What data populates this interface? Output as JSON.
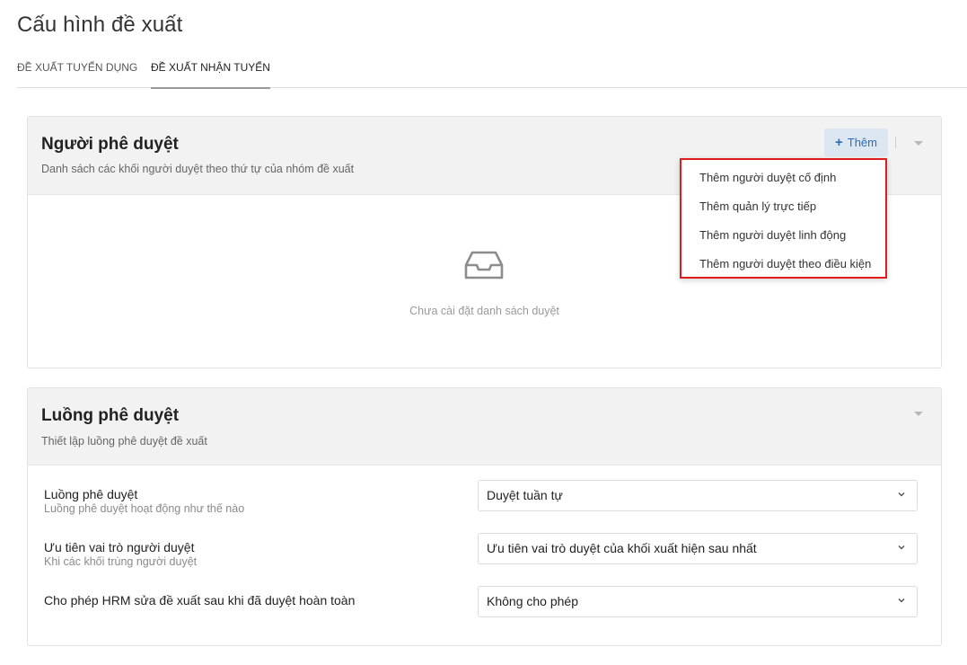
{
  "page": {
    "title": "Cấu hình đề xuất"
  },
  "tabs": [
    {
      "label": "ĐỀ XUẤT TUYỂN DỤNG",
      "active": false
    },
    {
      "label": "ĐỀ XUẤT NHẬN TUYỂN",
      "active": true
    }
  ],
  "approvers": {
    "title": "Người phê duyệt",
    "subtitle": "Danh sách các khối người duyệt theo thứ tự của nhóm đề xuất",
    "add_button": {
      "icon": "plus-icon",
      "label": "Thêm"
    },
    "empty_icon": "inbox-icon",
    "empty_text": "Chưa cài đặt danh sách duyệt",
    "menu": [
      "Thêm người duyệt cố định",
      "Thêm quản lý trực tiếp",
      "Thêm người duyệt linh động",
      "Thêm người duyệt theo điều kiện"
    ]
  },
  "flow": {
    "title": "Luồng phê duyệt",
    "subtitle": "Thiết lập luồng phê duyệt đề xuất",
    "rows": [
      {
        "label": "Luồng phê duyệt",
        "hint": "Luồng phê duyệt hoạt động như thế nào",
        "value": "Duyệt tuần tự"
      },
      {
        "label": "Ưu tiên vai trò người duyệt",
        "hint": "Khi các khối trùng người duyệt",
        "value": "Ưu tiên vai trò duyệt của khối xuất hiện sau nhất"
      },
      {
        "label": "Cho phép HRM sửa đề xuất sau khi đã duyệt hoàn toàn",
        "hint": "",
        "value": "Không cho phép"
      }
    ]
  },
  "colors": {
    "accent": "#2f6db5",
    "highlight_border": "#e01c1c",
    "header_bg": "#f2f2f2"
  }
}
